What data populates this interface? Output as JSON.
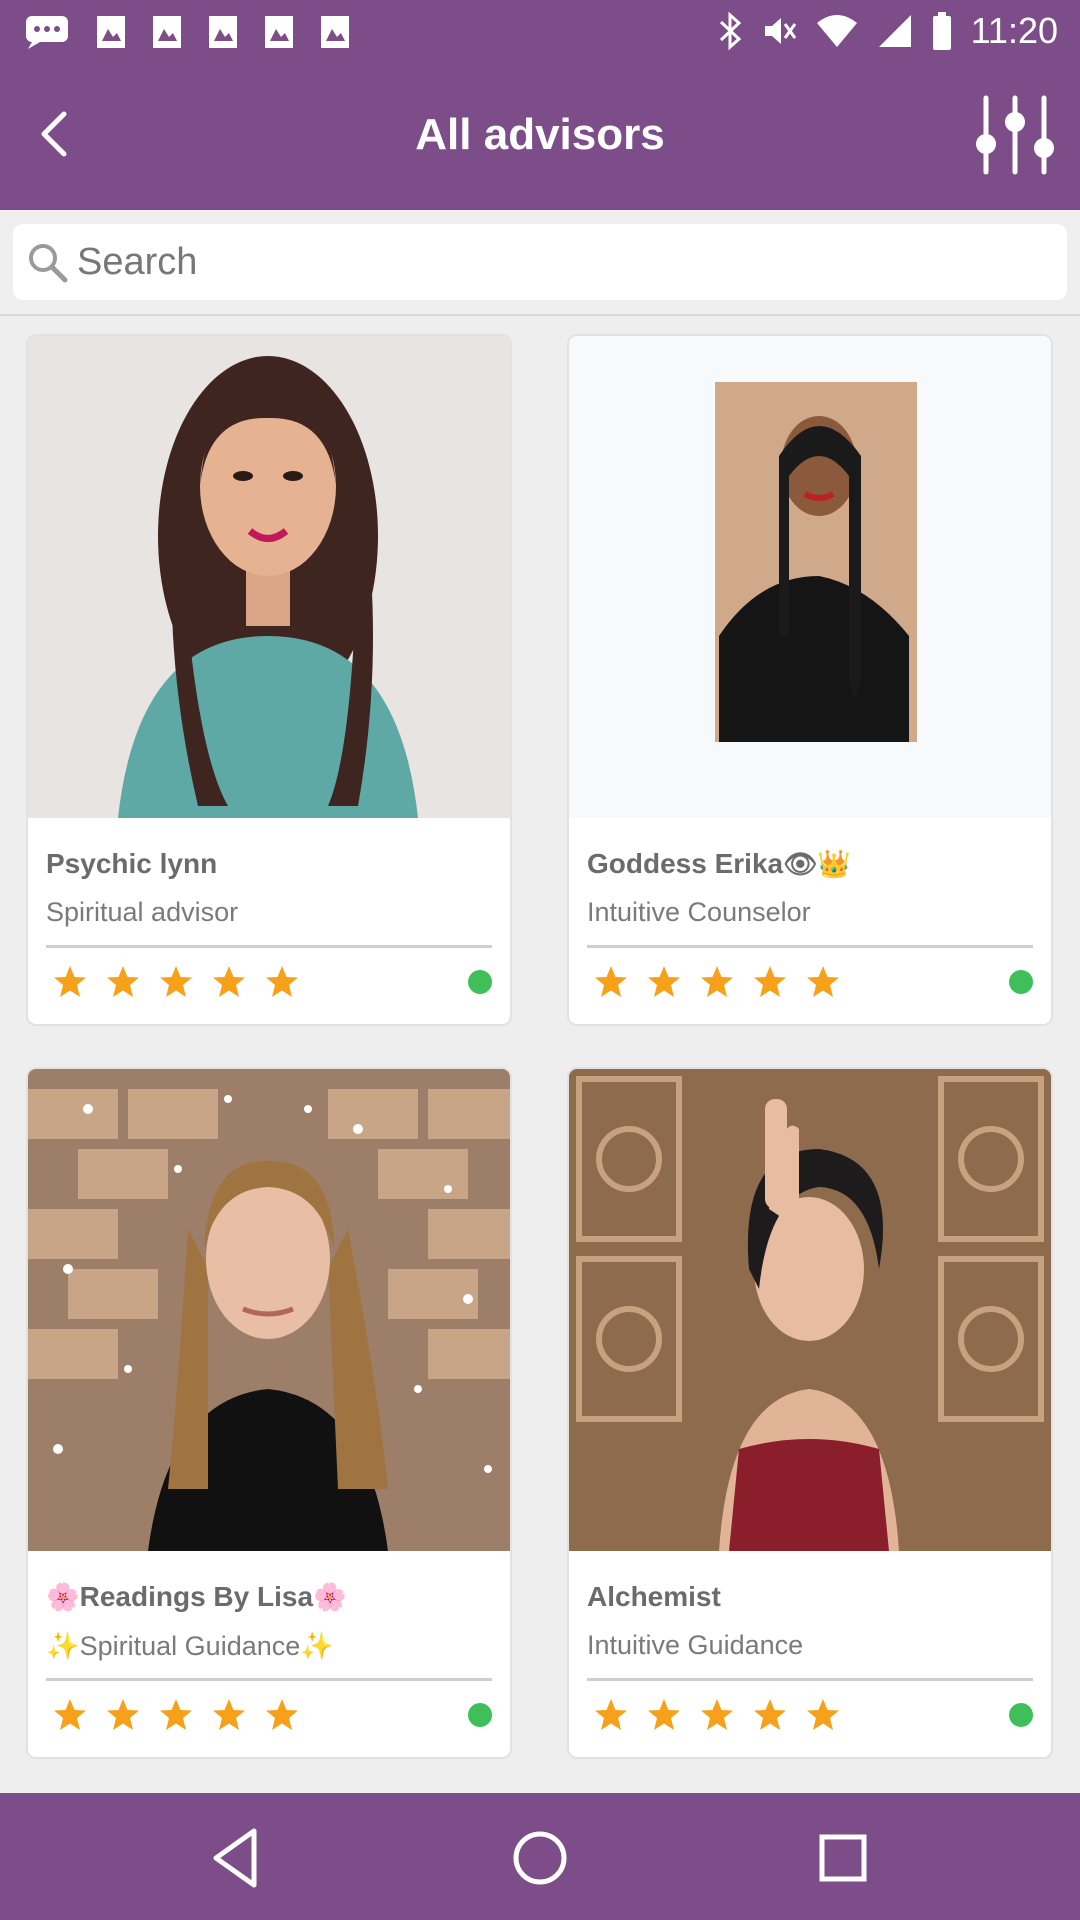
{
  "status_bar": {
    "time": "11:20",
    "icons": [
      "messages-icon",
      "image-icon",
      "image-icon",
      "image-icon",
      "image-icon",
      "image-icon",
      "bluetooth-icon",
      "mute-icon",
      "wifi-icon",
      "signal-icon",
      "battery-icon"
    ]
  },
  "header": {
    "title": "All advisors",
    "back_icon": "back-arrow-icon",
    "filter_icon": "filter-sliders-icon"
  },
  "search": {
    "placeholder": "Search",
    "value": ""
  },
  "advisors": [
    {
      "name": "Psychic lynn",
      "name_suffix": "",
      "name_prefix": "",
      "role": "Spiritual advisor",
      "role_prefix": "",
      "role_suffix": "",
      "rating": 5,
      "online": true,
      "photo": "photo-woman-teal-shirt"
    },
    {
      "name": "Goddess Erika",
      "name_suffix": "👁👑",
      "name_prefix": "",
      "role": "Intuitive Counselor",
      "role_prefix": "",
      "role_suffix": "",
      "rating": 5,
      "online": true,
      "photo": "photo-woman-braids"
    },
    {
      "name": "Readings By Lisa",
      "name_prefix": "🌸",
      "name_suffix": "🌸",
      "role": "Spiritual Guidance",
      "role_prefix": "✨",
      "role_suffix": "✨",
      "rating": 5,
      "online": true,
      "photo": "photo-woman-sparkles"
    },
    {
      "name": "Alchemist",
      "name_suffix": "",
      "name_prefix": "",
      "role": "Intuitive Guidance",
      "role_prefix": "",
      "role_suffix": "",
      "rating": 5,
      "online": true,
      "photo": "photo-woman-carved-wall"
    }
  ],
  "colors": {
    "brand": "#7d4d8a",
    "star": "#f7a11a",
    "online": "#3fbf5a"
  },
  "nav": {
    "icons": [
      "back-triangle-icon",
      "home-circle-icon",
      "recents-square-icon"
    ]
  }
}
